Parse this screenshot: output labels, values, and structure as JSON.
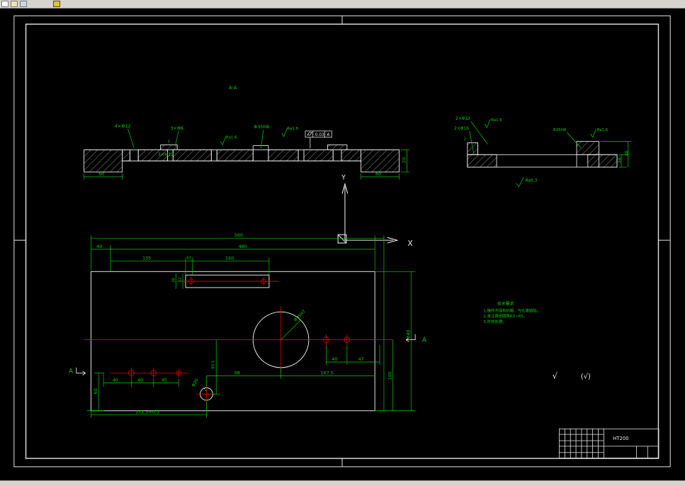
{
  "toolbar": {
    "icons": [
      "new-file",
      "open-folder",
      "save",
      "app"
    ]
  },
  "aa": {
    "title": "A-A",
    "d_4xd12": "4×Φ12",
    "d_3xd6": "3×Φ6",
    "d_3xm12": "3×M12",
    "d_d35": "Φ35H8",
    "ra1": "Ra1.6",
    "ra2": "Ra1.6",
    "small3": "3",
    "tol_value": "0.03",
    "tol_datum": "A",
    "w_left": "60",
    "w_right": "60",
    "height": "20"
  },
  "rs": {
    "d_2xd12": "2×Φ12",
    "d_2xd16": "2×Φ16",
    "d_d35": "Φ35H8",
    "ra1": "Ra1.6",
    "ra2": "Ra1.6",
    "ra_all": "Ra6.3",
    "h20": "20",
    "h40": "40",
    "small2": "2"
  },
  "ucs": {
    "x_label": "X",
    "y_label": "Y"
  },
  "plan": {
    "w560": "560",
    "w480": "480",
    "w40": "40",
    "w135": "135",
    "w10": "10",
    "w140": "140",
    "s38": "38",
    "s12": "12",
    "d35": "Φ35H7",
    "g40": "40",
    "g47": "47",
    "g167": "167.5",
    "g98": "98",
    "b40a": "40",
    "b40b": "40",
    "b45": "45",
    "v60": "60",
    "v90": "90.5",
    "d20": "Φ20",
    "b171": "171.5+0.3",
    "v340": "340",
    "v100": "100",
    "sec_left": "A",
    "sec_right": "A"
  },
  "notes": {
    "title": "技术要求",
    "n1": "1.铸件不得有砂眼、气孔等缺陷。",
    "n2": "2.未注铸造圆角R3~R5。",
    "n3": "3.时效处理。"
  },
  "finish": {
    "main": "√",
    "bracket": "(√)"
  },
  "tb": {
    "material": "HT200"
  }
}
